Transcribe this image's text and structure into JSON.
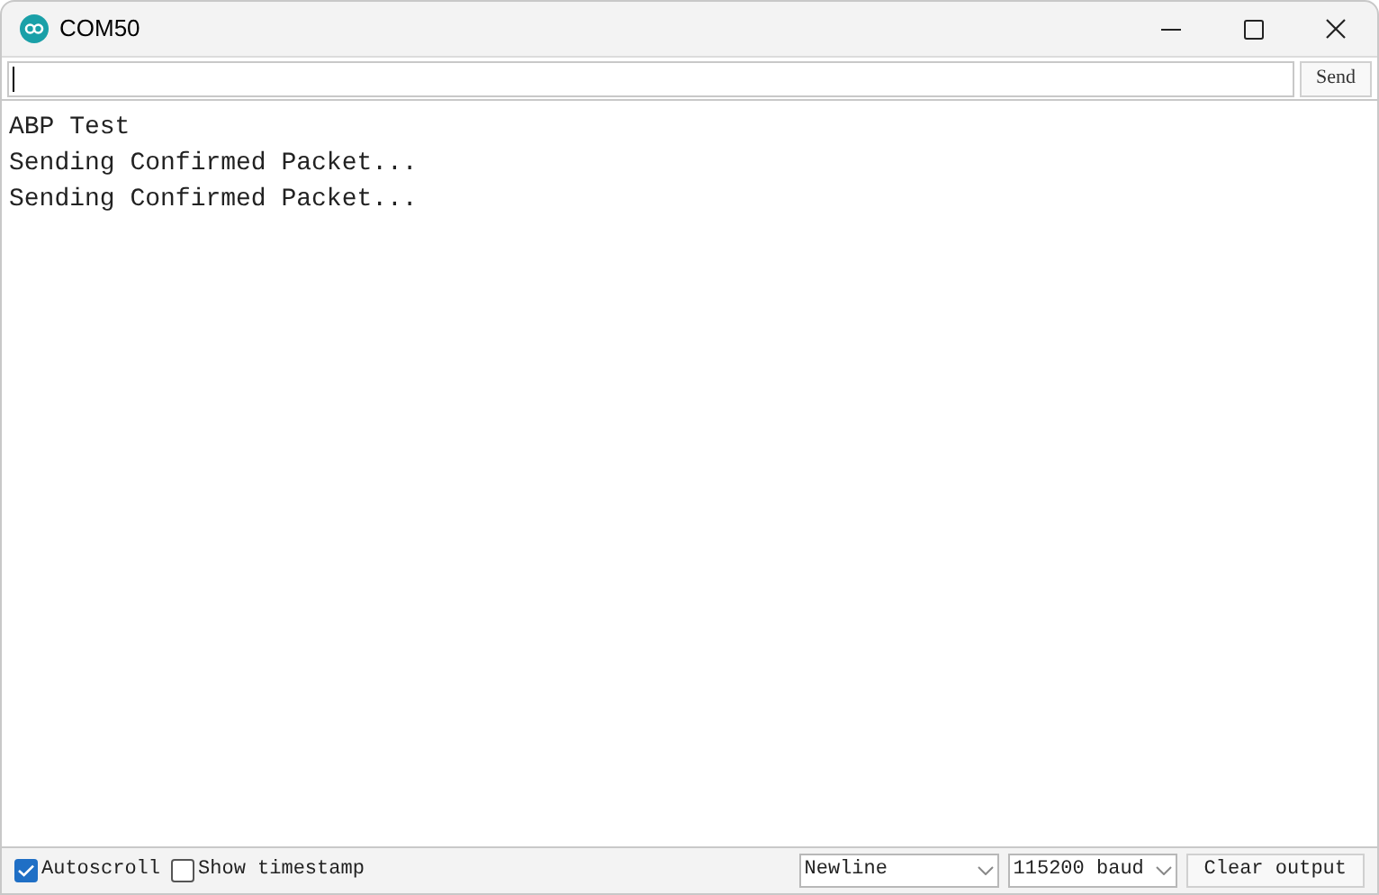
{
  "window": {
    "title": "COM50"
  },
  "send_button": {
    "label": "Send"
  },
  "output_lines": [
    "ABP Test",
    "Sending Confirmed Packet...",
    "Sending Confirmed Packet..."
  ],
  "autoscroll": {
    "label": "Autoscroll",
    "checked": true
  },
  "show_timestamp": {
    "label": "Show timestamp",
    "checked": false
  },
  "line_ending": {
    "value": "Newline"
  },
  "baud_rate": {
    "value": "115200 baud"
  },
  "clear_button": {
    "label": "Clear output"
  }
}
